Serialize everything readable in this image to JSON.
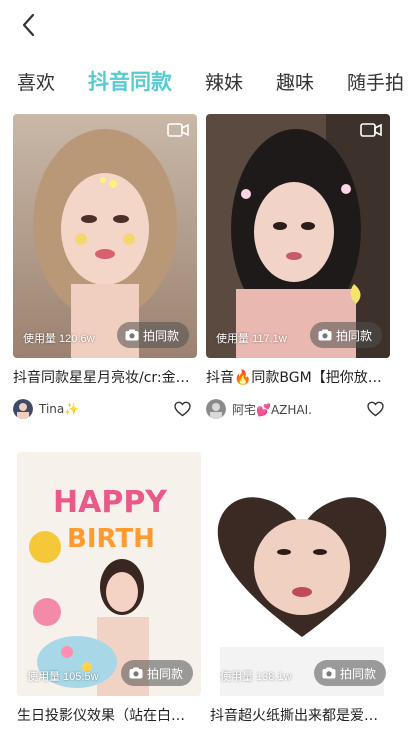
{
  "header": {
    "back_icon": "chevron-left-icon"
  },
  "tabs": [
    {
      "label": "喜欢",
      "active": false
    },
    {
      "label": "抖音同款",
      "active": true
    },
    {
      "label": "辣妹",
      "active": false
    },
    {
      "label": "趣味",
      "active": false
    },
    {
      "label": "随手拍",
      "active": false
    }
  ],
  "accent_color": "#57cbd0",
  "cards": [
    {
      "usage": "使用量 120.6w",
      "action": "拍同款",
      "title": "抖音同款星星月亮妆/cr:金…",
      "author": "Tina✨",
      "has_video_icon": true
    },
    {
      "usage": "使用量 117.1w",
      "action": "拍同款",
      "title": "抖音🔥同款BGM【把你放…",
      "author": "阿宅💕AZHAI.",
      "has_video_icon": true
    },
    {
      "usage": "使用量 105.5w",
      "action": "拍同款",
      "title": "生日投影仪效果（站在白墙…",
      "has_video_icon": false
    },
    {
      "usage": "使用量 138.1w",
      "action": "拍同款",
      "title": "抖音超火纸撕出来都是爱你…",
      "has_video_icon": false
    }
  ]
}
